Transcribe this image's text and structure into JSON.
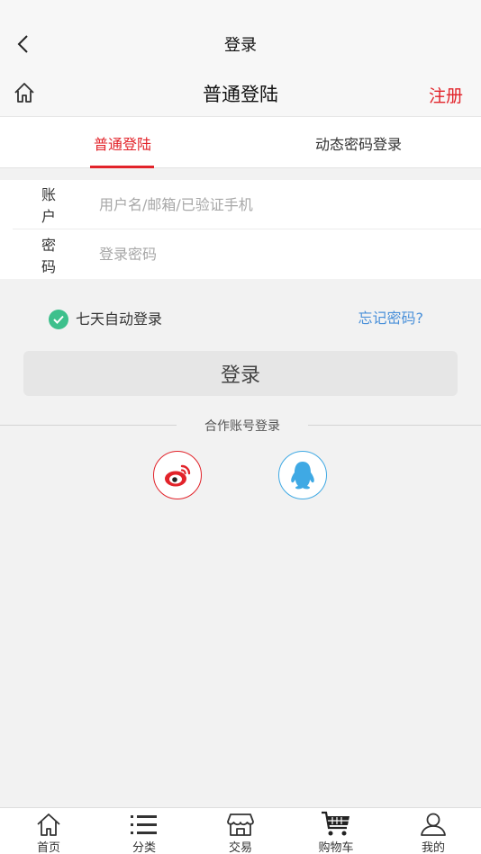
{
  "header": {
    "title": "登录"
  },
  "subheader": {
    "title": "普通登陆",
    "register_label": "注册"
  },
  "tabs": [
    {
      "label": "普通登陆",
      "active": true
    },
    {
      "label": "动态密码登录",
      "active": false
    }
  ],
  "form": {
    "account": {
      "label": "账户",
      "placeholder": "用户名/邮箱/已验证手机"
    },
    "password": {
      "label": "密码",
      "placeholder": "登录密码"
    }
  },
  "remember": {
    "label": "七天自动登录",
    "checked": true
  },
  "forgot_label": "忘记密码?",
  "login_button": "登录",
  "partner": {
    "label": "合作账号登录",
    "providers": [
      "weibo-icon",
      "qq-icon"
    ]
  },
  "tabbar": [
    {
      "label": "首页",
      "icon": "home-icon"
    },
    {
      "label": "分类",
      "icon": "list-icon"
    },
    {
      "label": "交易",
      "icon": "shop-icon"
    },
    {
      "label": "购物车",
      "icon": "cart-icon"
    },
    {
      "label": "我的",
      "icon": "user-icon"
    }
  ],
  "colors": {
    "accent": "#e2232a",
    "link": "#4a90d9",
    "check": "#3dc08c",
    "qq": "#3fa9e4"
  }
}
